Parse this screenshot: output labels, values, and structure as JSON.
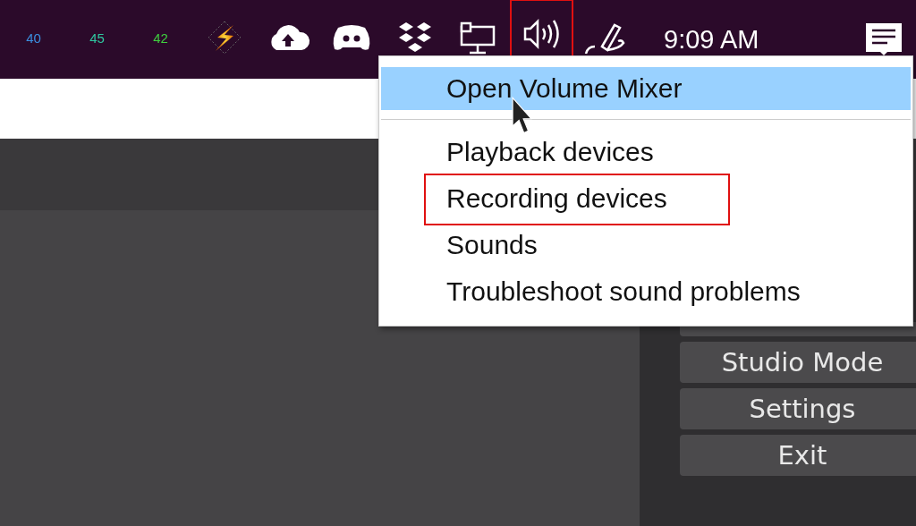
{
  "taskbar": {
    "tray": [
      {
        "kind": "reading",
        "text": "40",
        "color": "#3b8fe0"
      },
      {
        "kind": "reading",
        "text": "45",
        "color": "#2fc7a0"
      },
      {
        "kind": "reading",
        "text": "42",
        "color": "#3fcf3f"
      },
      {
        "kind": "bolt",
        "outlined": false
      },
      {
        "kind": "cloud",
        "outlined": false
      },
      {
        "kind": "chat",
        "outlined": false
      },
      {
        "kind": "boxes",
        "outlined": false
      },
      {
        "kind": "monitor",
        "outlined": false
      },
      {
        "kind": "speaker",
        "outlined": true
      },
      {
        "kind": "pen",
        "outlined": false
      }
    ],
    "clock": "9:09 AM"
  },
  "context_menu": {
    "items": [
      {
        "label": "Open Volume Mixer",
        "selected": true,
        "outlined": false,
        "separator_after": true
      },
      {
        "label": "Playback devices",
        "selected": false,
        "outlined": false,
        "separator_after": false
      },
      {
        "label": "Recording devices",
        "selected": false,
        "outlined": true,
        "separator_after": false
      },
      {
        "label": "Sounds",
        "selected": false,
        "outlined": false,
        "separator_after": false
      },
      {
        "label": "Troubleshoot sound problems",
        "selected": false,
        "outlined": false,
        "separator_after": false
      }
    ]
  },
  "controls": {
    "buttons": [
      {
        "label": "Studio Mode"
      },
      {
        "label": "Settings"
      },
      {
        "label": "Exit"
      }
    ]
  }
}
